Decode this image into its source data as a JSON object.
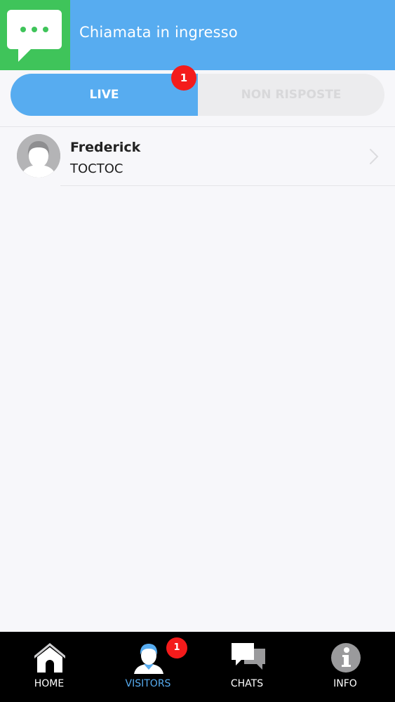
{
  "header": {
    "title": "Chiamata in ingresso",
    "icon": "chat-bubble-icon",
    "colors": {
      "banner": "#57acf0",
      "icon_box": "#3fc45a"
    }
  },
  "tabs": {
    "items": [
      {
        "label": "LIVE",
        "active": true
      },
      {
        "label": "NON RISPOSTE",
        "active": false
      }
    ],
    "live_badge": "1"
  },
  "visitors": [
    {
      "name": "Frederick",
      "subtitle": "TOCTOC",
      "avatar": "default-avatar-icon"
    }
  ],
  "bottom_nav": {
    "items": [
      {
        "label": "HOME",
        "icon": "home-icon",
        "active": false
      },
      {
        "label": "VISITORS",
        "icon": "visitor-icon",
        "active": true
      },
      {
        "label": "CHATS",
        "icon": "chats-icon",
        "active": false
      },
      {
        "label": "INFO",
        "icon": "info-icon",
        "active": false
      }
    ],
    "visitors_badge": "1"
  },
  "colors": {
    "accent": "#57acf0",
    "green": "#3fc45a",
    "badge_red": "#f41b1b"
  }
}
